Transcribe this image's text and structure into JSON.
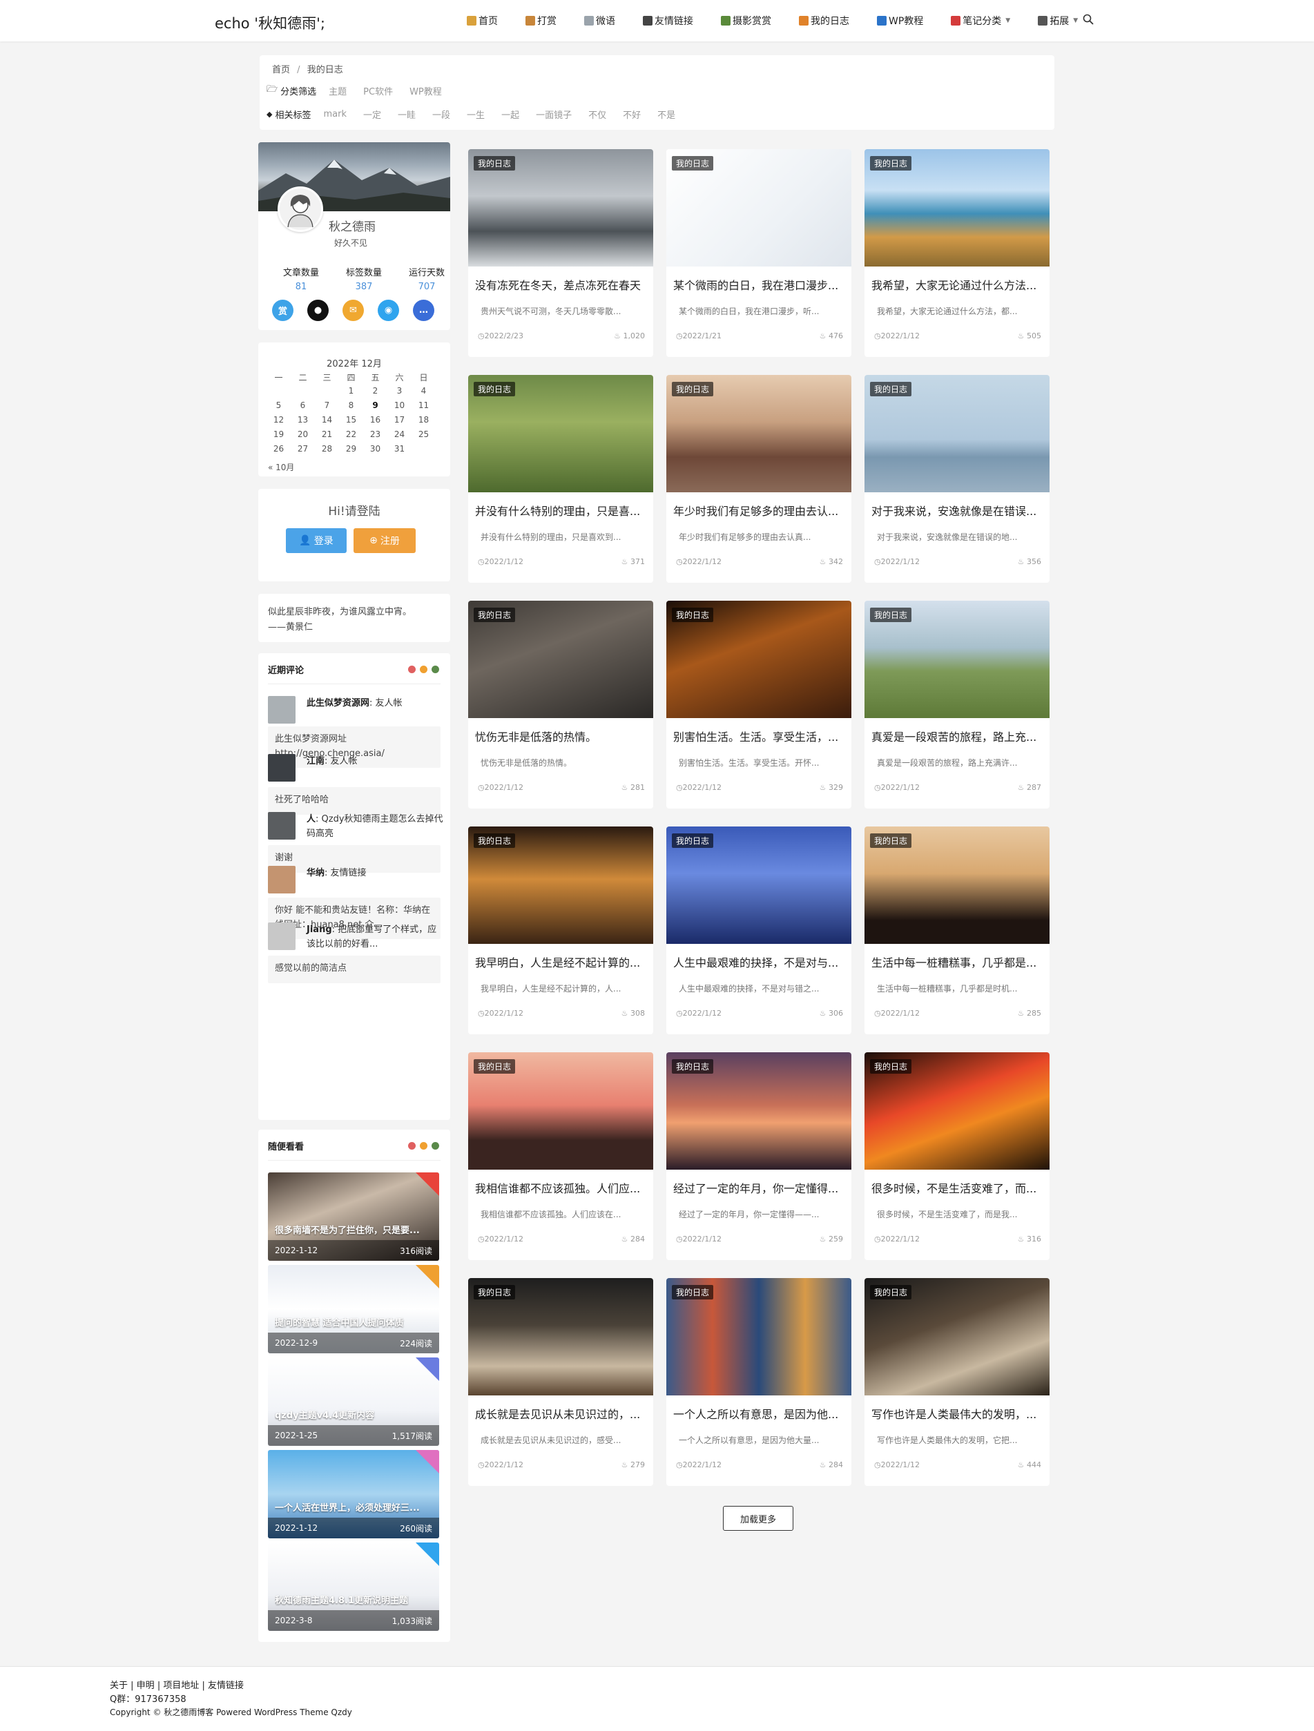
{
  "header": {
    "logo": "echo '秋知德雨';",
    "nav": [
      {
        "label": "首页",
        "icon": "home-icon",
        "color": "#d9a13b"
      },
      {
        "label": "打赏",
        "icon": "gift-icon",
        "color": "#c8863a"
      },
      {
        "label": "微语",
        "icon": "note-icon",
        "color": "#9aa3ab"
      },
      {
        "label": "友情链接",
        "icon": "link-icon",
        "color": "#444444"
      },
      {
        "label": "摄影赏赏",
        "icon": "photo-icon",
        "color": "#5a8a3a"
      },
      {
        "label": "我的日志",
        "icon": "diary-icon",
        "color": "#e0822a"
      },
      {
        "label": "WP教程",
        "icon": "book-icon",
        "color": "#2b73c9"
      },
      {
        "label": "笔记分类",
        "icon": "notebook-icon",
        "color": "#d43b3b"
      },
      {
        "label": "拓展",
        "icon": "globe-icon",
        "color": "#555555"
      }
    ]
  },
  "breadcrumb": {
    "home": "首页",
    "sep": "/",
    "current": "我的日志"
  },
  "filters": {
    "category_label": "分类筛选",
    "categories": [
      "主题",
      "PC软件",
      "WP教程"
    ],
    "tag_label": "相关标签",
    "tags": [
      "mark",
      "一定",
      "一眭",
      "一段",
      "一生",
      "一起",
      "一面镜子",
      "不仅",
      "不好",
      "不是"
    ]
  },
  "profile": {
    "name": "秋之德雨",
    "desc": "好久不见",
    "stats": [
      {
        "label": "文章数量",
        "value": "81"
      },
      {
        "label": "标签数量",
        "value": "387"
      },
      {
        "label": "运行天数",
        "value": "707"
      }
    ],
    "icons": [
      {
        "name": "reward-icon",
        "glyph": "赏",
        "color": "#3ea3e8"
      },
      {
        "name": "github-icon",
        "glyph": "●",
        "color": "#111111"
      },
      {
        "name": "mail-icon",
        "glyph": "✉",
        "color": "#f0a830"
      },
      {
        "name": "qq-icon",
        "glyph": "◉",
        "color": "#2fa4ee"
      },
      {
        "name": "chat-icon",
        "glyph": "…",
        "color": "#3a6dd8"
      }
    ]
  },
  "calendar": {
    "title": "2022年 12月",
    "weekdays": [
      "一",
      "二",
      "三",
      "四",
      "五",
      "六",
      "日"
    ],
    "days": [
      "",
      "",
      "",
      "1",
      "2",
      "3",
      "4",
      "5",
      "6",
      "7",
      "8",
      "9",
      "10",
      "11",
      "12",
      "13",
      "14",
      "15",
      "16",
      "17",
      "18",
      "19",
      "20",
      "21",
      "22",
      "23",
      "24",
      "25",
      "26",
      "27",
      "28",
      "29",
      "30",
      "31",
      ""
    ],
    "today": "9",
    "prev": "« 10月"
  },
  "login": {
    "title": "Hi!请登陆",
    "login_btn": "登录",
    "register_btn": "注册",
    "login_color": "#4ba3e8",
    "register_color": "#f0a03c"
  },
  "quote": {
    "line1": "似此星辰非昨夜，为谁风露立中宵。",
    "line2": "——黄景仁"
  },
  "recent_comments": {
    "title": "近期评论",
    "dots": [
      "#e06060",
      "#f0a030",
      "#5a8a4a"
    ],
    "items": [
      {
        "author": "此生似梦资源网",
        "action": ": 友人帐",
        "body": "此生似梦资源网址 http://geno.chenge.asia/"
      },
      {
        "author": "江南",
        "action": ": 友人帐",
        "body": "社死了哈哈哈"
      },
      {
        "author": "人",
        "action": ": Qzdy秋知德雨主题怎么去掉代码高亮",
        "body": "谢谢"
      },
      {
        "author": "华纳",
        "action": ": 友情链接",
        "body": "你好 能不能和贵站友链！名称：华纳在线网址：huana8.net 介..."
      },
      {
        "author": "Jiang",
        "action": ": 把底部重写了个样式，应该比以前的好看...",
        "body": "感觉以前的简洁点"
      }
    ]
  },
  "random_posts": {
    "title": "随便看看",
    "items": [
      {
        "title": "很多南墙不是为了拦住你，只是要...",
        "date": "2022-1-12",
        "views": "316阅读",
        "corner": "#e8433a"
      },
      {
        "title": "提问的智慧 适合中国人提问体质",
        "date": "2022-12-9",
        "views": "224阅读",
        "corner": "#f0a030"
      },
      {
        "title": "qzdy主题v4.4更新内容",
        "date": "2022-1-25",
        "views": "1,517阅读",
        "corner": "#6a7ce0"
      },
      {
        "title": "一个人活在世界上，必须处理好三...",
        "date": "2022-1-12",
        "views": "260阅读",
        "corner": "#e070c0"
      },
      {
        "title": "秋知德雨主题4.8.1更新说明主题",
        "date": "2022-3-8",
        "views": "1,033阅读",
        "corner": "#2fa4ee"
      }
    ]
  },
  "posts": [
    {
      "tag": "我的日志",
      "title": "没有冻死在冬天，差点冻死在春天",
      "excerpt": "贵州天气说不可测，冬天几场零零散...",
      "date": "2022/2/23",
      "views": "1,020"
    },
    {
      "tag": "我的日志",
      "title": "某个微雨的白日，我在港口漫步...",
      "excerpt": "某个微雨的白日，我在港口漫步，听...",
      "date": "2022/1/21",
      "views": "476"
    },
    {
      "tag": "我的日志",
      "title": "我希望，大家无论通过什么方法...",
      "excerpt": "我希望，大家无论通过什么方法，都...",
      "date": "2022/1/12",
      "views": "505"
    },
    {
      "tag": "我的日志",
      "title": "并没有什么特别的理由，只是喜...",
      "excerpt": "并没有什么特别的理由，只是喜欢到...",
      "date": "2022/1/12",
      "views": "371"
    },
    {
      "tag": "我的日志",
      "title": "年少时我们有足够多的理由去认...",
      "excerpt": "年少时我们有足够多的理由去认真...",
      "date": "2022/1/12",
      "views": "342"
    },
    {
      "tag": "我的日志",
      "title": "对于我来说，安逸就像是在错误...",
      "excerpt": "对于我来说，安逸就像是在错误的地...",
      "date": "2022/1/12",
      "views": "356"
    },
    {
      "tag": "我的日志",
      "title": "忧伤无非是低落的热情。",
      "excerpt": "忧伤无非是低落的热情。",
      "date": "2022/1/12",
      "views": "281"
    },
    {
      "tag": "我的日志",
      "title": "别害怕生活。生活。享受生活，...",
      "excerpt": "别害怕生活。生活。享受生活。开怀...",
      "date": "2022/1/12",
      "views": "329"
    },
    {
      "tag": "我的日志",
      "title": "真爱是一段艰苦的旅程，路上充...",
      "excerpt": "真爱是一段艰苦的旅程，路上充满许...",
      "date": "2022/1/12",
      "views": "287"
    },
    {
      "tag": "我的日志",
      "title": "我早明白，人生是经不起计算的...",
      "excerpt": "我早明白，人生是经不起计算的，人...",
      "date": "2022/1/12",
      "views": "308"
    },
    {
      "tag": "我的日志",
      "title": "人生中最艰难的抉择，不是对与...",
      "excerpt": "人生中最艰难的抉择，不是对与错之...",
      "date": "2022/1/12",
      "views": "306"
    },
    {
      "tag": "我的日志",
      "title": "生活中每一桩糟糕事，几乎都是...",
      "excerpt": "生活中每一桩糟糕事，几乎都是时机...",
      "date": "2022/1/12",
      "views": "285"
    },
    {
      "tag": "我的日志",
      "title": "我相信谁都不应该孤独。人们应...",
      "excerpt": "我相信谁都不应该孤独。人们应该在...",
      "date": "2022/1/12",
      "views": "284"
    },
    {
      "tag": "我的日志",
      "title": "经过了一定的年月，你一定懂得...",
      "excerpt": "经过了一定的年月，你一定懂得——...",
      "date": "2022/1/12",
      "views": "259"
    },
    {
      "tag": "我的日志",
      "title": "很多时候，不是生活变难了，而...",
      "excerpt": "很多时候，不是生活变难了，而是我...",
      "date": "2022/1/12",
      "views": "316"
    },
    {
      "tag": "我的日志",
      "title": "成长就是去见识从未见识过的，...",
      "excerpt": "成长就是去见识从未见识过的，感受...",
      "date": "2022/1/12",
      "views": "279"
    },
    {
      "tag": "我的日志",
      "title": "一个人之所以有意思，是因为他...",
      "excerpt": "一个人之所以有意思，是因为他大量...",
      "date": "2022/1/12",
      "views": "284"
    },
    {
      "tag": "我的日志",
      "title": "写作也许是人类最伟大的发明，...",
      "excerpt": "写作也许是人类最伟大的发明，它把...",
      "date": "2022/1/12",
      "views": "444"
    }
  ],
  "load_more": "加载更多",
  "footer": {
    "links": [
      "关于",
      "申明",
      "项目地址",
      "友情链接"
    ],
    "qq": "Q群：917367358",
    "copyright_prefix": "Copyright ©",
    "site": "秋之德雨博客",
    "powered": "Powered WordPress Theme Qzdy"
  }
}
